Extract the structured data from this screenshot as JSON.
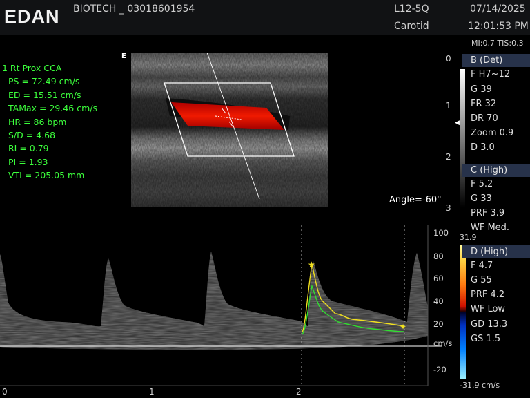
{
  "header": {
    "logo": "EDAN",
    "patient_id": "BIOTECH _ 03018601954",
    "probe": "L12-5Q",
    "preset": "Carotid",
    "date": "07/14/2025",
    "time": "12:01:53 PM",
    "indices": "MI:0.7   TIS:0.3"
  },
  "measurements": {
    "title": "1 Rt Prox CCA",
    "items": [
      "PS = 72.49 cm/s",
      "ED = 15.51 cm/s",
      "TAMax = 29.46 cm/s",
      "HR = 86 bpm",
      "S/D = 4.68",
      "RI = 0.79",
      "PI = 1.93",
      "VTI = 205.05 mm"
    ]
  },
  "image": {
    "e_marker": "E",
    "angle": "Angle=-60°",
    "depth_scale": [
      "0",
      "1",
      "2",
      "3"
    ]
  },
  "panel": {
    "b_mode": {
      "title": "B (Det)",
      "params": [
        "F H7~12",
        "G 39",
        "FR 32",
        "DR 70",
        "Zoom 0.9",
        "D 3.0"
      ]
    },
    "c_mode": {
      "title": "C (High)",
      "params": [
        "F 5.2",
        "G 33",
        "PRF 3.9",
        "WF Med."
      ]
    },
    "d_mode": {
      "title": "D (High)",
      "params": [
        "F 4.7",
        "G 55",
        "PRF 4.2",
        "WF Low",
        "GD 13.3",
        "GS 1.5"
      ]
    },
    "color_bar_top": "31.9",
    "color_bar_bottom": "-31.9 cm/s"
  },
  "spectrum": {
    "velocity_labels": [
      "100",
      "80",
      "60",
      "40",
      "20",
      "cm/s",
      "-20"
    ],
    "time_labels": [
      "0",
      "1",
      "2"
    ]
  },
  "colors": {
    "measurement_text": "#3cff3c",
    "color_flow": "#e01000",
    "envelope_max": "#f0e020",
    "envelope_mean": "#30e030",
    "section_header": "#27324a"
  }
}
